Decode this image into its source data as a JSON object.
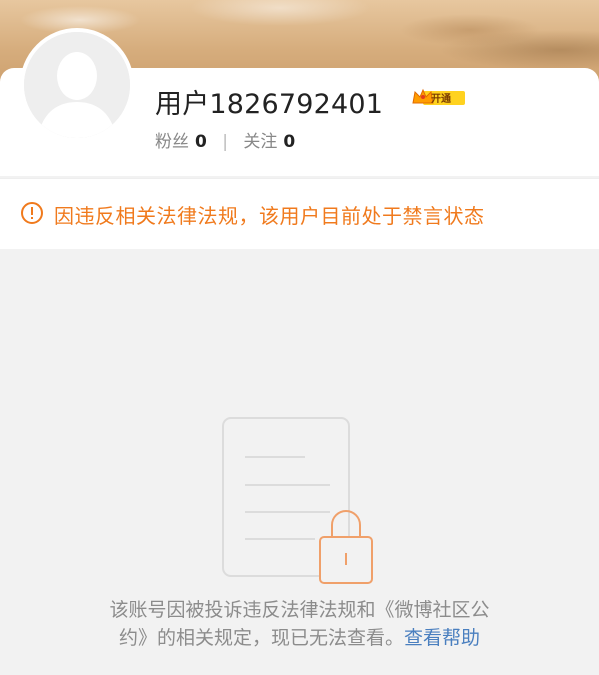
{
  "profile": {
    "username": "用户1826792401",
    "vip_label": "开通",
    "followers_label": "粉丝",
    "followers_count": "0",
    "following_label": "关注",
    "following_count": "0"
  },
  "notice": {
    "text": "因违反相关法律法规，该用户目前处于禁言状态"
  },
  "footer": {
    "line1": "该账号因被投诉违反法律法规和《微博社区公",
    "line2": "约》的相关规定，现已无法查看。",
    "help_link": "查看帮助"
  },
  "colors": {
    "accent_orange": "#f07a1d",
    "link_blue": "#4a7fbf",
    "lock_orange": "#f0a06a"
  }
}
